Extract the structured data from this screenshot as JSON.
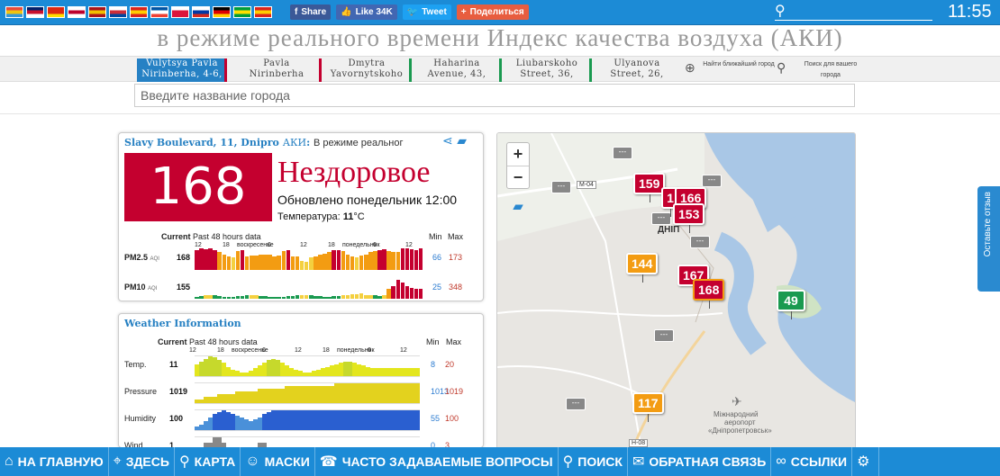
{
  "topbar": {
    "flags": [
      {
        "name": "rainbow-flag",
        "colors": [
          "#e74c3c",
          "#f1c40f",
          "#3498db"
        ]
      },
      {
        "name": "uk-flag",
        "colors": [
          "#012169",
          "#c8102e",
          "#ffffff"
        ]
      },
      {
        "name": "china-flag",
        "colors": [
          "#de2910",
          "#de2910",
          "#ffde00"
        ]
      },
      {
        "name": "japan-flag",
        "colors": [
          "#ffffff",
          "#bc002d",
          "#ffffff"
        ]
      },
      {
        "name": "spain-flag",
        "colors": [
          "#aa151b",
          "#f1bf00",
          "#aa151b"
        ]
      },
      {
        "name": "korea-flag",
        "colors": [
          "#ffffff",
          "#cd2e3a",
          "#0047a0"
        ]
      },
      {
        "name": "vietnam-flag-alt",
        "colors": [
          "#da251d",
          "#ffcd00",
          "#da251d"
        ]
      },
      {
        "name": "france-flag",
        "colors": [
          "#0055a4",
          "#ffffff",
          "#ef4135"
        ]
      },
      {
        "name": "poland-flag",
        "colors": [
          "#ffffff",
          "#dc143c",
          "#dc143c"
        ]
      },
      {
        "name": "russia-flag",
        "colors": [
          "#ffffff",
          "#0039a6",
          "#d52b1e"
        ]
      },
      {
        "name": "germany-flag",
        "colors": [
          "#000000",
          "#dd0000",
          "#ffce00"
        ]
      },
      {
        "name": "brazil-flag",
        "colors": [
          "#009c3b",
          "#ffdf00",
          "#009c3b"
        ]
      },
      {
        "name": "vietnam-flag",
        "colors": [
          "#da251d",
          "#ffcd00",
          "#da251d"
        ]
      }
    ],
    "share": [
      {
        "name": "facebook-share-button",
        "icon": "f",
        "label": "Share",
        "color": "#3b5998"
      },
      {
        "name": "facebook-like-button",
        "icon": "👍",
        "label": "Like 34K",
        "color": "#4267b2"
      },
      {
        "name": "twitter-tweet-button",
        "icon": "🐦",
        "label": "Tweet",
        "color": "#1da1f2"
      },
      {
        "name": "share-plus-button",
        "icon": "+",
        "label": "Поделиться",
        "color": "#e85d3f"
      }
    ],
    "clock": "11:55"
  },
  "title": "в режиме реального времени Индекс качества воздуха (АКИ)",
  "stations": [
    {
      "line1": "Vulytsya Pavla",
      "line2": "Nirinberha, 4-6,",
      "color": "#c4002f",
      "active": true
    },
    {
      "line1": "Pavla",
      "line2": "Nirinberha",
      "color": "#c4002f",
      "active": false
    },
    {
      "line1": "Dmytra",
      "line2": "Yavornytskoho",
      "color": "#1a9a50",
      "active": false
    },
    {
      "line1": "Haharina",
      "line2": "Avenue, 43,",
      "color": "#1a9a50",
      "active": false
    },
    {
      "line1": "Liubarskoho",
      "line2": "Street, 36,",
      "color": "#1a9a50",
      "active": false
    },
    {
      "line1": "Ulyanova",
      "line2": "Street, 26,",
      "color": "#1a9a50",
      "active": false
    }
  ],
  "tools": {
    "nearest": "Найти ближайший город",
    "search": "Поиск для вашего города"
  },
  "city_search": {
    "placeholder": "Введите название города"
  },
  "aqi": {
    "station": "Slavy Boulevard, 11, Dnipro",
    "aqi_word": "АКИ",
    "realtime": "В режиме реальног",
    "value": "168",
    "value_color": "#c4002f",
    "status": "Нездоровое",
    "updated": "Обновлено понедельник 12:00",
    "temp_label": "Температура:",
    "temp_value": "11",
    "temp_unit": "°C"
  },
  "aqi_chart_head": {
    "current": "Current",
    "past": "Past 48 hours data",
    "min": "Min",
    "max": "Max"
  },
  "aqi_ticks": [
    "12",
    "18",
    "воскресенье",
    "6",
    "12",
    "18",
    "понедельник",
    "6",
    "12"
  ],
  "pollutants": [
    {
      "label": "PM2.5",
      "sub": "AQI",
      "current": "168",
      "min": "66",
      "max": "173"
    },
    {
      "label": "PM10",
      "sub": "AQI",
      "current": "155",
      "min": "25",
      "max": "348"
    }
  ],
  "weather": {
    "title": "Weather Information",
    "head": {
      "current": "Current",
      "past": "Past 48 hours data",
      "min": "Min",
      "max": "Max"
    },
    "ticks": [
      "12",
      "18",
      "воскресенье",
      "6",
      "12",
      "18",
      "понедельник",
      "6",
      "12"
    ],
    "rows": [
      {
        "label": "Temp.",
        "current": "11",
        "min": "8",
        "max": "20"
      },
      {
        "label": "Pressure",
        "current": "1019",
        "min": "1013",
        "max": "1019"
      },
      {
        "label": "Humidity",
        "current": "100",
        "min": "55",
        "max": "100"
      },
      {
        "label": "Wind",
        "current": "1",
        "min": "0",
        "max": "3"
      }
    ]
  },
  "map": {
    "markers": [
      {
        "value": "159",
        "color": "#c4002f"
      },
      {
        "value": "1",
        "color": "#c4002f"
      },
      {
        "value": "166",
        "color": "#c4002f"
      },
      {
        "value": "153",
        "color": "#c4002f"
      },
      {
        "value": "144",
        "color": "#f39c12"
      },
      {
        "value": "167",
        "color": "#c4002f"
      },
      {
        "value": "168",
        "color": "#c4002f"
      },
      {
        "value": "49",
        "color": "#1a9a50"
      },
      {
        "value": "117",
        "color": "#f39c12"
      }
    ],
    "pin_text": "---",
    "road1": "M-04",
    "road2": "H-08",
    "city_label": "ДНІП",
    "airport_line1": "Міжнародний",
    "airport_line2": "аеропорт",
    "airport_line3": "«Дніпропетровськ»"
  },
  "feedback": "Оставьте отзыв",
  "bottomnav": [
    {
      "name": "nav-home",
      "icon": "⌂",
      "label": "НА ГЛАВНУЮ"
    },
    {
      "name": "nav-here",
      "icon": "⌖",
      "label": "ЗДЕСЬ"
    },
    {
      "name": "nav-map",
      "icon": "⚲",
      "label": "КАРТА"
    },
    {
      "name": "nav-masks",
      "icon": "☺",
      "label": "МАСКИ"
    },
    {
      "name": "nav-faq",
      "icon": "☎",
      "label": "ЧАСТО ЗАДАВАЕМЫЕ ВОПРОСЫ"
    },
    {
      "name": "nav-search",
      "icon": "⚲",
      "label": "ПОИСК"
    },
    {
      "name": "nav-feedback",
      "icon": "✉",
      "label": "ОБРАТНАЯ СВЯЗЬ"
    },
    {
      "name": "nav-links",
      "icon": "∞",
      "label": "ССЫЛКИ"
    },
    {
      "name": "nav-settings",
      "icon": "⚙",
      "label": ""
    }
  ]
}
